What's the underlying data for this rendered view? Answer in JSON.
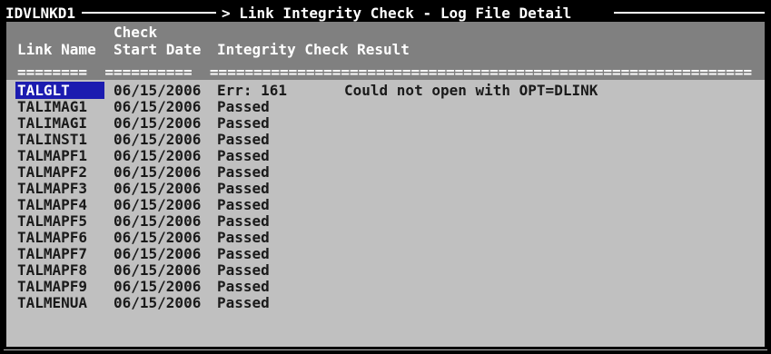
{
  "window": {
    "program_id": "IDVLNKD1",
    "title": "> Link Integrity Check - Log File Detail"
  },
  "columns": {
    "check_label": "Check",
    "link_name": "Link Name",
    "start_date": "Start Date",
    "result": "Integrity Check Result"
  },
  "separator": "========  ==========  ==============================================================",
  "rows": [
    {
      "name": "TALGLT",
      "date": "06/15/2006",
      "result": "Err: 161",
      "message": "Could not open with OPT=DLINK",
      "selected": true
    },
    {
      "name": "TALIMAG1",
      "date": "06/15/2006",
      "result": "Passed",
      "message": ""
    },
    {
      "name": "TALIMAGI",
      "date": "06/15/2006",
      "result": "Passed",
      "message": ""
    },
    {
      "name": "TALINST1",
      "date": "06/15/2006",
      "result": "Passed",
      "message": ""
    },
    {
      "name": "TALMAPF1",
      "date": "06/15/2006",
      "result": "Passed",
      "message": ""
    },
    {
      "name": "TALMAPF2",
      "date": "06/15/2006",
      "result": "Passed",
      "message": ""
    },
    {
      "name": "TALMAPF3",
      "date": "06/15/2006",
      "result": "Passed",
      "message": ""
    },
    {
      "name": "TALMAPF4",
      "date": "06/15/2006",
      "result": "Passed",
      "message": ""
    },
    {
      "name": "TALMAPF5",
      "date": "06/15/2006",
      "result": "Passed",
      "message": ""
    },
    {
      "name": "TALMAPF6",
      "date": "06/15/2006",
      "result": "Passed",
      "message": ""
    },
    {
      "name": "TALMAPF7",
      "date": "06/15/2006",
      "result": "Passed",
      "message": ""
    },
    {
      "name": "TALMAPF8",
      "date": "06/15/2006",
      "result": "Passed",
      "message": ""
    },
    {
      "name": "TALMAPF9",
      "date": "06/15/2006",
      "result": "Passed",
      "message": ""
    },
    {
      "name": "TALMENUA",
      "date": "06/15/2006",
      "result": "Passed",
      "message": ""
    }
  ],
  "colors": {
    "background": "#c0c0c0",
    "header_bg": "#808080",
    "selection": "#1c1cb0"
  }
}
